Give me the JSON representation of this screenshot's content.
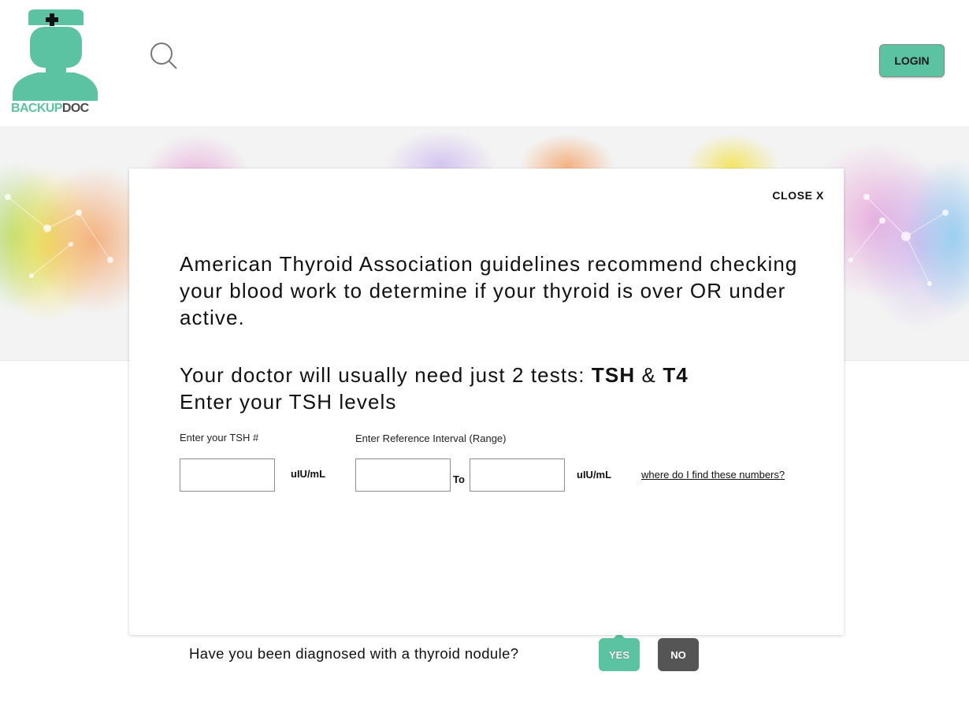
{
  "header": {
    "logo_part1": "BACKUP",
    "logo_part2": "DOC",
    "login_label": "LOGIN"
  },
  "colors": {
    "brand_green": "#5cc3a2",
    "no_button": "#555555"
  },
  "question": {
    "text": "Have you been diagnosed with a thyroid nodule?",
    "yes_label": "YES",
    "no_label": "NO"
  },
  "modal": {
    "close_label": "CLOSE X",
    "intro": "American Thyroid Association guidelines recommend checking your blood work to determine if your thyroid is over OR under active.",
    "tests_prefix": "Your doctor will usually need just 2 tests: ",
    "test1": "TSH",
    "amp": " & ",
    "test2": "T4",
    "enter_levels": "Enter your TSH levels",
    "tsh_label": "Enter your TSH #",
    "range_label": "Enter Reference Interval (Range)",
    "tsh_value": "",
    "range_low_value": "",
    "range_high_value": "",
    "unit": "uIU/mL",
    "to_label": "To",
    "help_link": "where do I find these numbers?"
  }
}
